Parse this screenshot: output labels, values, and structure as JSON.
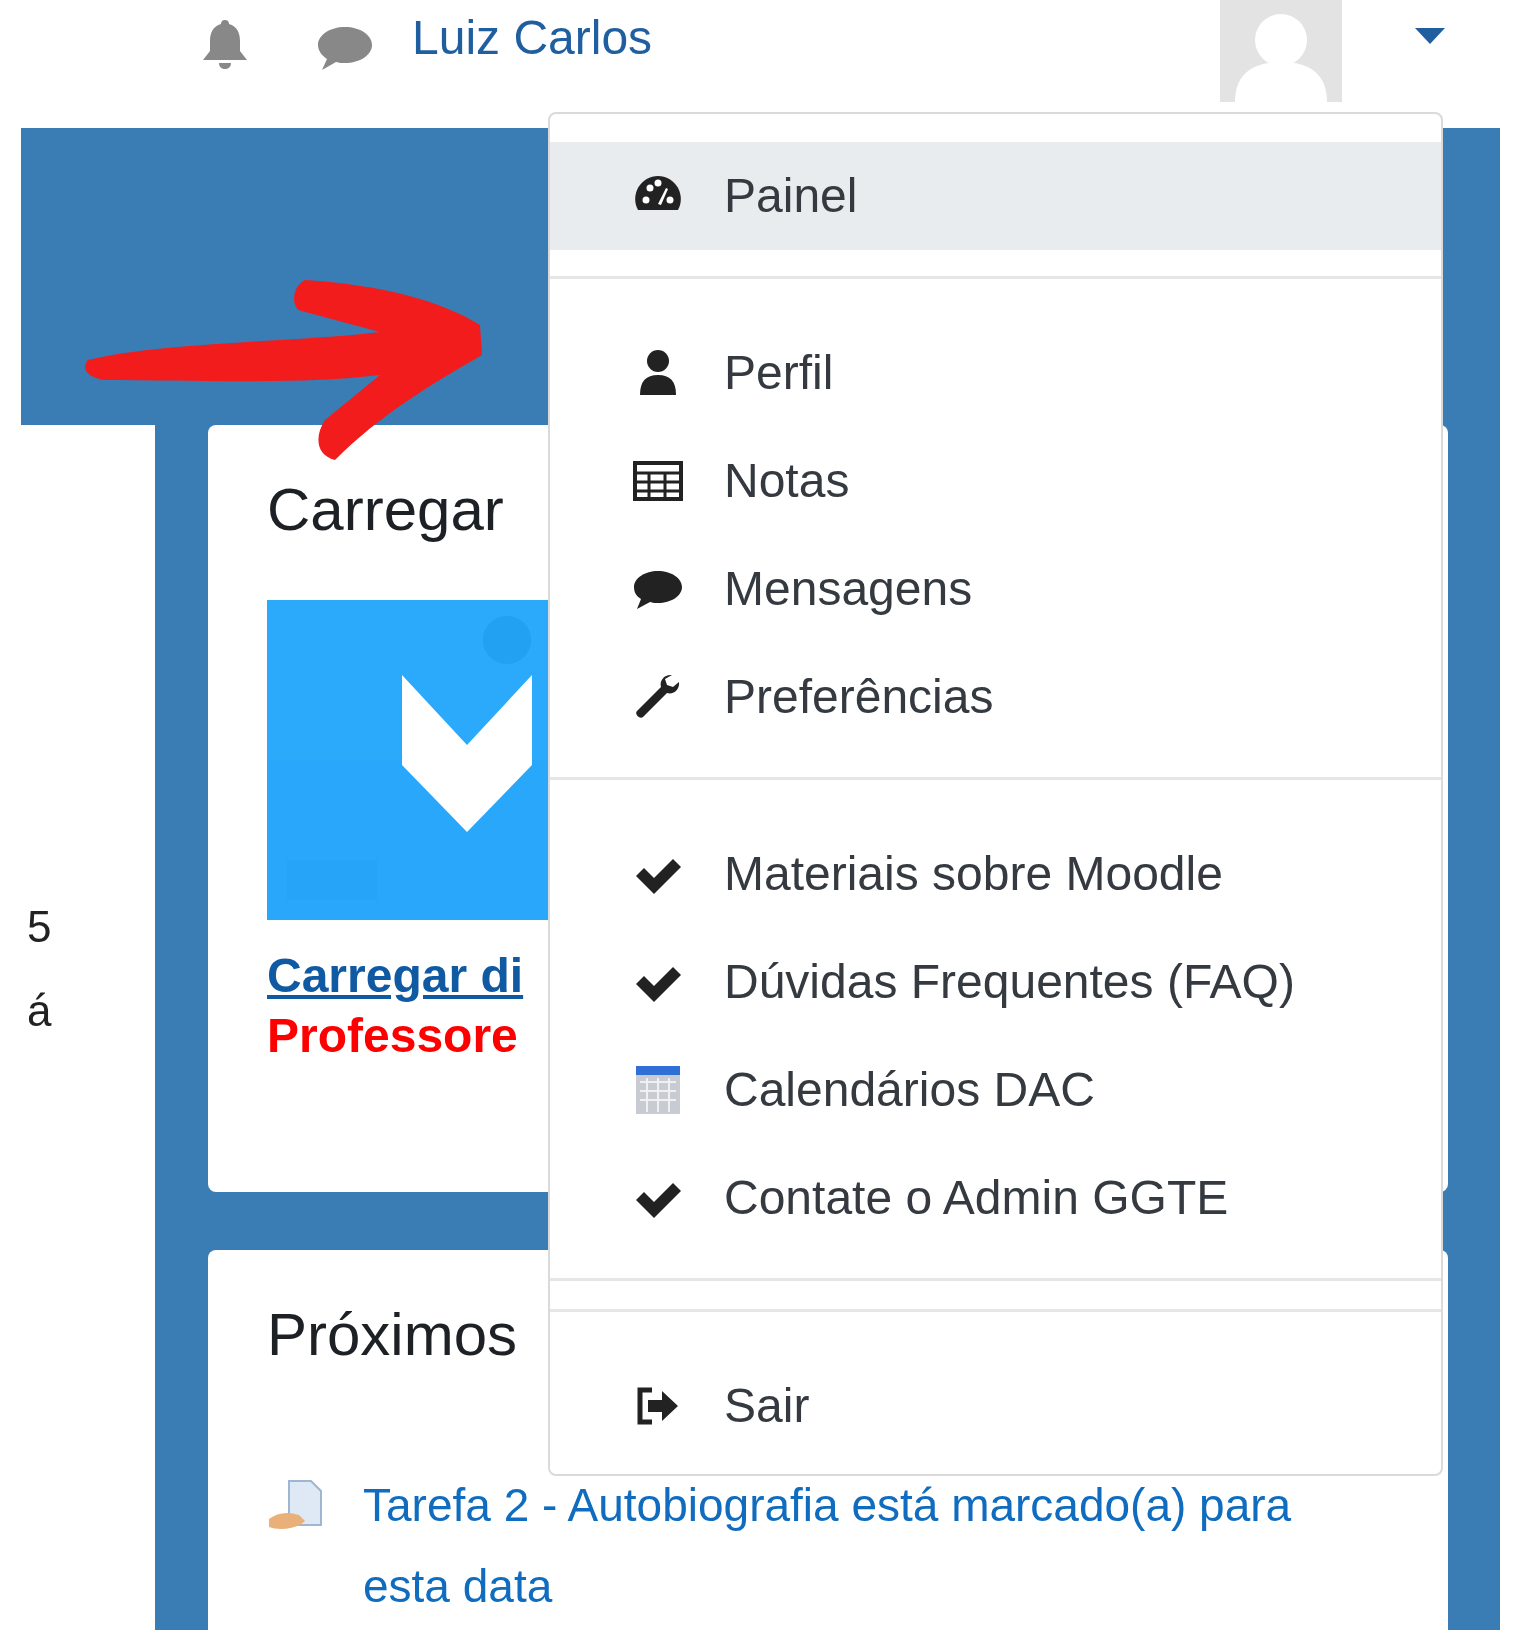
{
  "header": {
    "user_name": "Luiz Carlos"
  },
  "left_panel": {
    "texts": [
      "5",
      "á"
    ]
  },
  "cards": [
    {
      "title": "Carregar",
      "kind": "upload",
      "link": "Carregar di",
      "note": "Professore"
    },
    {
      "title": "Próximos",
      "kind": "events",
      "event": "Tarefa 2 - Autobiografia está marcado(a) para esta data"
    }
  ],
  "user_menu": {
    "groups": [
      [
        {
          "label": "Painel",
          "selected": true
        }
      ],
      [
        {
          "label": "Perfil",
          "selected": false
        },
        {
          "label": "Notas",
          "selected": false
        },
        {
          "label": "Mensagens",
          "selected": false
        },
        {
          "label": "Preferências",
          "selected": false
        }
      ],
      [
        {
          "label": "Materiais sobre Moodle",
          "selected": false
        },
        {
          "label": "Dúvidas Frequentes (FAQ)",
          "selected": false
        },
        {
          "label": "Calendários DAC",
          "selected": false
        },
        {
          "label": "Contate o Admin GGTE",
          "selected": false
        }
      ],
      [
        {
          "label": "Sair",
          "selected": false
        }
      ]
    ]
  }
}
